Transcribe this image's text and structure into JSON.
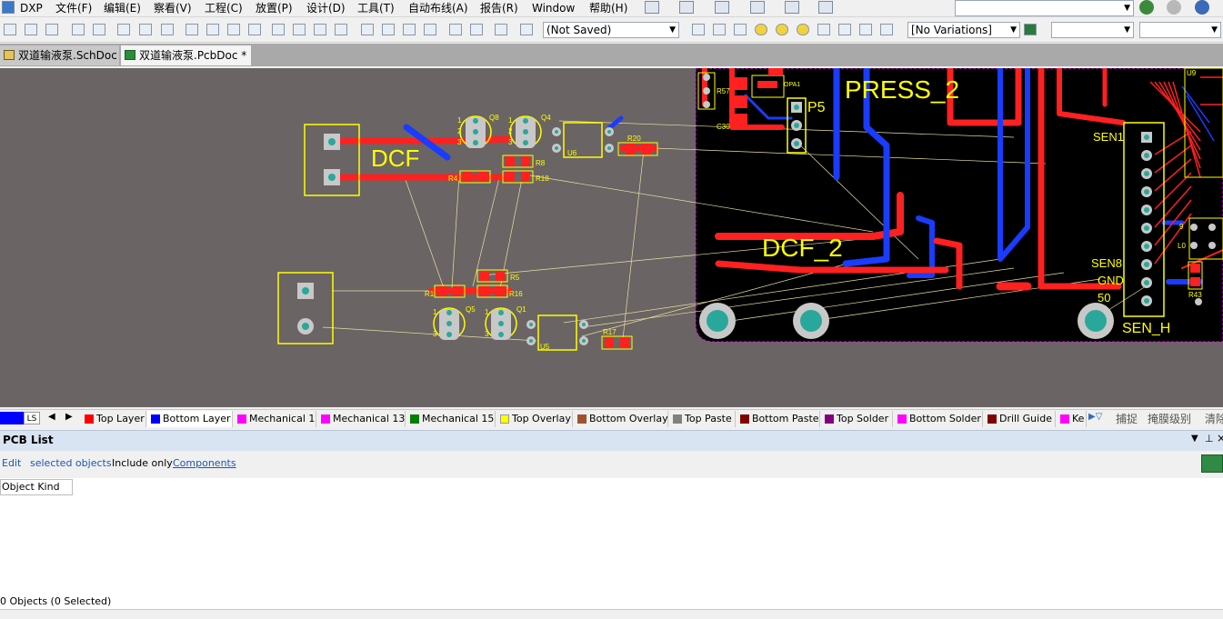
{
  "menubar": {
    "app_label": "DXP",
    "items": [
      "文件(F)",
      "编辑(E)",
      "察看(V)",
      "工程(C)",
      "放置(P)",
      "设计(D)",
      "工具(T)",
      "自动布线(A)",
      "报告(R)",
      "Window",
      "帮助(H)"
    ]
  },
  "toolbar": {
    "saved_state": "(Not Saved)",
    "variations": "[No Variations]",
    "blank_dropdown": ""
  },
  "tabs": [
    {
      "label": "双道输液泵.SchDoc",
      "active": false
    },
    {
      "label": "双道输液泵.PcbDoc *",
      "active": true
    }
  ],
  "pcb": {
    "labels": {
      "dcf": "DCF",
      "dcf2": "DCF_2",
      "press2": "PRESS_2",
      "p5": "P5",
      "sen_h": "SEN_H",
      "sen1": "SEN1",
      "sen8": "SEN8",
      "gnd": "GND",
      "fifty": "50"
    },
    "refdes": {
      "q8": "Q8",
      "q4": "Q4",
      "u6": "U6",
      "r20": "R20",
      "r8": "R8",
      "r4": "R4",
      "r18": "R18",
      "r5": "R5",
      "r1": "R1",
      "r16": "R16",
      "q5": "Q5",
      "q1": "Q1",
      "u5": "U5",
      "r17": "R17",
      "r57": "R57",
      "c30": "C30",
      "opa": "OPA1",
      "u9": "U9",
      "r43": "R43",
      "l0": "L0",
      "n9": "9",
      "pin1": "1",
      "pin2": "2",
      "pin3": "3"
    }
  },
  "layers": {
    "current": "LS",
    "items": [
      {
        "label": "Top Layer",
        "color": "#ff0000"
      },
      {
        "label": "Bottom Layer",
        "color": "#0000ff",
        "active": true
      },
      {
        "label": "Mechanical 1",
        "color": "#ff00ff"
      },
      {
        "label": "Mechanical 13",
        "color": "#ff00ff"
      },
      {
        "label": "Mechanical 15",
        "color": "#008000"
      },
      {
        "label": "Top Overlay",
        "color": "#ffff00"
      },
      {
        "label": "Bottom Overlay",
        "color": "#a0522d"
      },
      {
        "label": "Top Paste",
        "color": "#808080"
      },
      {
        "label": "Bottom Paste",
        "color": "#800000"
      },
      {
        "label": "Top Solder",
        "color": "#800080"
      },
      {
        "label": "Bottom Solder",
        "color": "#ff00ff"
      },
      {
        "label": "Drill Guide",
        "color": "#800000"
      },
      {
        "label": "Ke",
        "color": "#ff00ff"
      }
    ],
    "right_items": [
      "捕捉",
      "掩膜级别",
      "清除"
    ]
  },
  "panel": {
    "title": "PCB List",
    "edit": "Edit",
    "selected_objects": "selected objects",
    "include_only": "Include only",
    "components": "Components",
    "column": "Object Kind",
    "footer": "0 Objects (0 Selected)"
  }
}
